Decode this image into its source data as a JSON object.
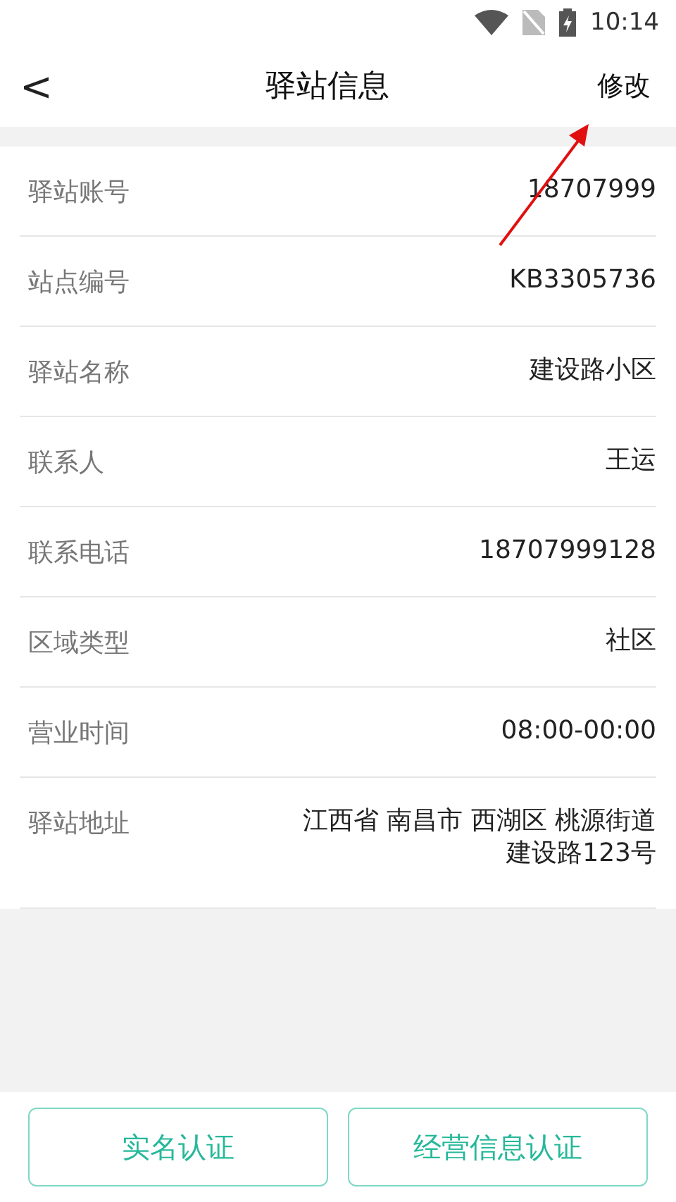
{
  "status_bar": {
    "time": "10:14"
  },
  "header": {
    "back": "<",
    "title": "驿站信息",
    "action": "修改"
  },
  "fields": [
    {
      "label": "驿站账号",
      "value": "18707999"
    },
    {
      "label": "站点编号",
      "value": "KB3305736"
    },
    {
      "label": "驿站名称",
      "value": "建设路小区"
    },
    {
      "label": "联系人",
      "value": "王运"
    },
    {
      "label": "联系电话",
      "value": "18707999128"
    },
    {
      "label": "区域类型",
      "value": "社区"
    },
    {
      "label": "营业时间",
      "value": "08:00-00:00"
    },
    {
      "label": "驿站地址",
      "lines": [
        "江西省 南昌市 西湖区 桃源街道",
        "建设路123号"
      ]
    }
  ],
  "buttons": [
    "实名认证",
    "经营信息认证"
  ]
}
